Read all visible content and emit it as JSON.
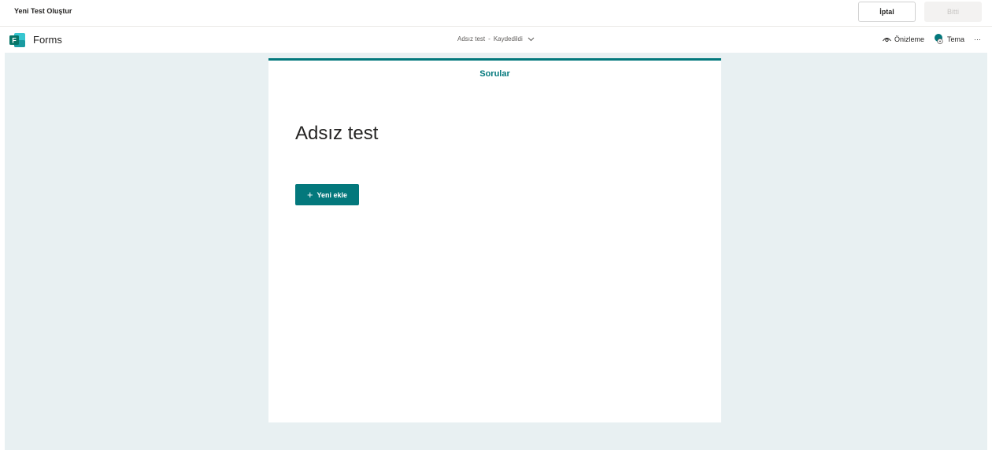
{
  "dialog": {
    "title": "Yeni Test Oluştur",
    "cancel_label": "İptal",
    "done_label": "Bitti"
  },
  "forms_bar": {
    "app_name": "Forms",
    "document_name": "Adsız test",
    "separator": "-",
    "save_status": "Kaydedildi",
    "preview_label": "Önizleme",
    "theme_label": "Tema",
    "more_label": "···"
  },
  "form": {
    "tab_label": "Sorular",
    "title": "Adsız test",
    "add_new_plus": "+",
    "add_new_label": "Yeni ekle"
  },
  "colors": {
    "accent": "#03787c",
    "canvas": "#e8f0f2",
    "logo_green": "#077568"
  },
  "icons": {
    "logo": "forms-logo-icon",
    "preview": "eye-icon",
    "theme": "palette-icon",
    "chevron": "chevron-down-icon",
    "more": "more-icon"
  }
}
